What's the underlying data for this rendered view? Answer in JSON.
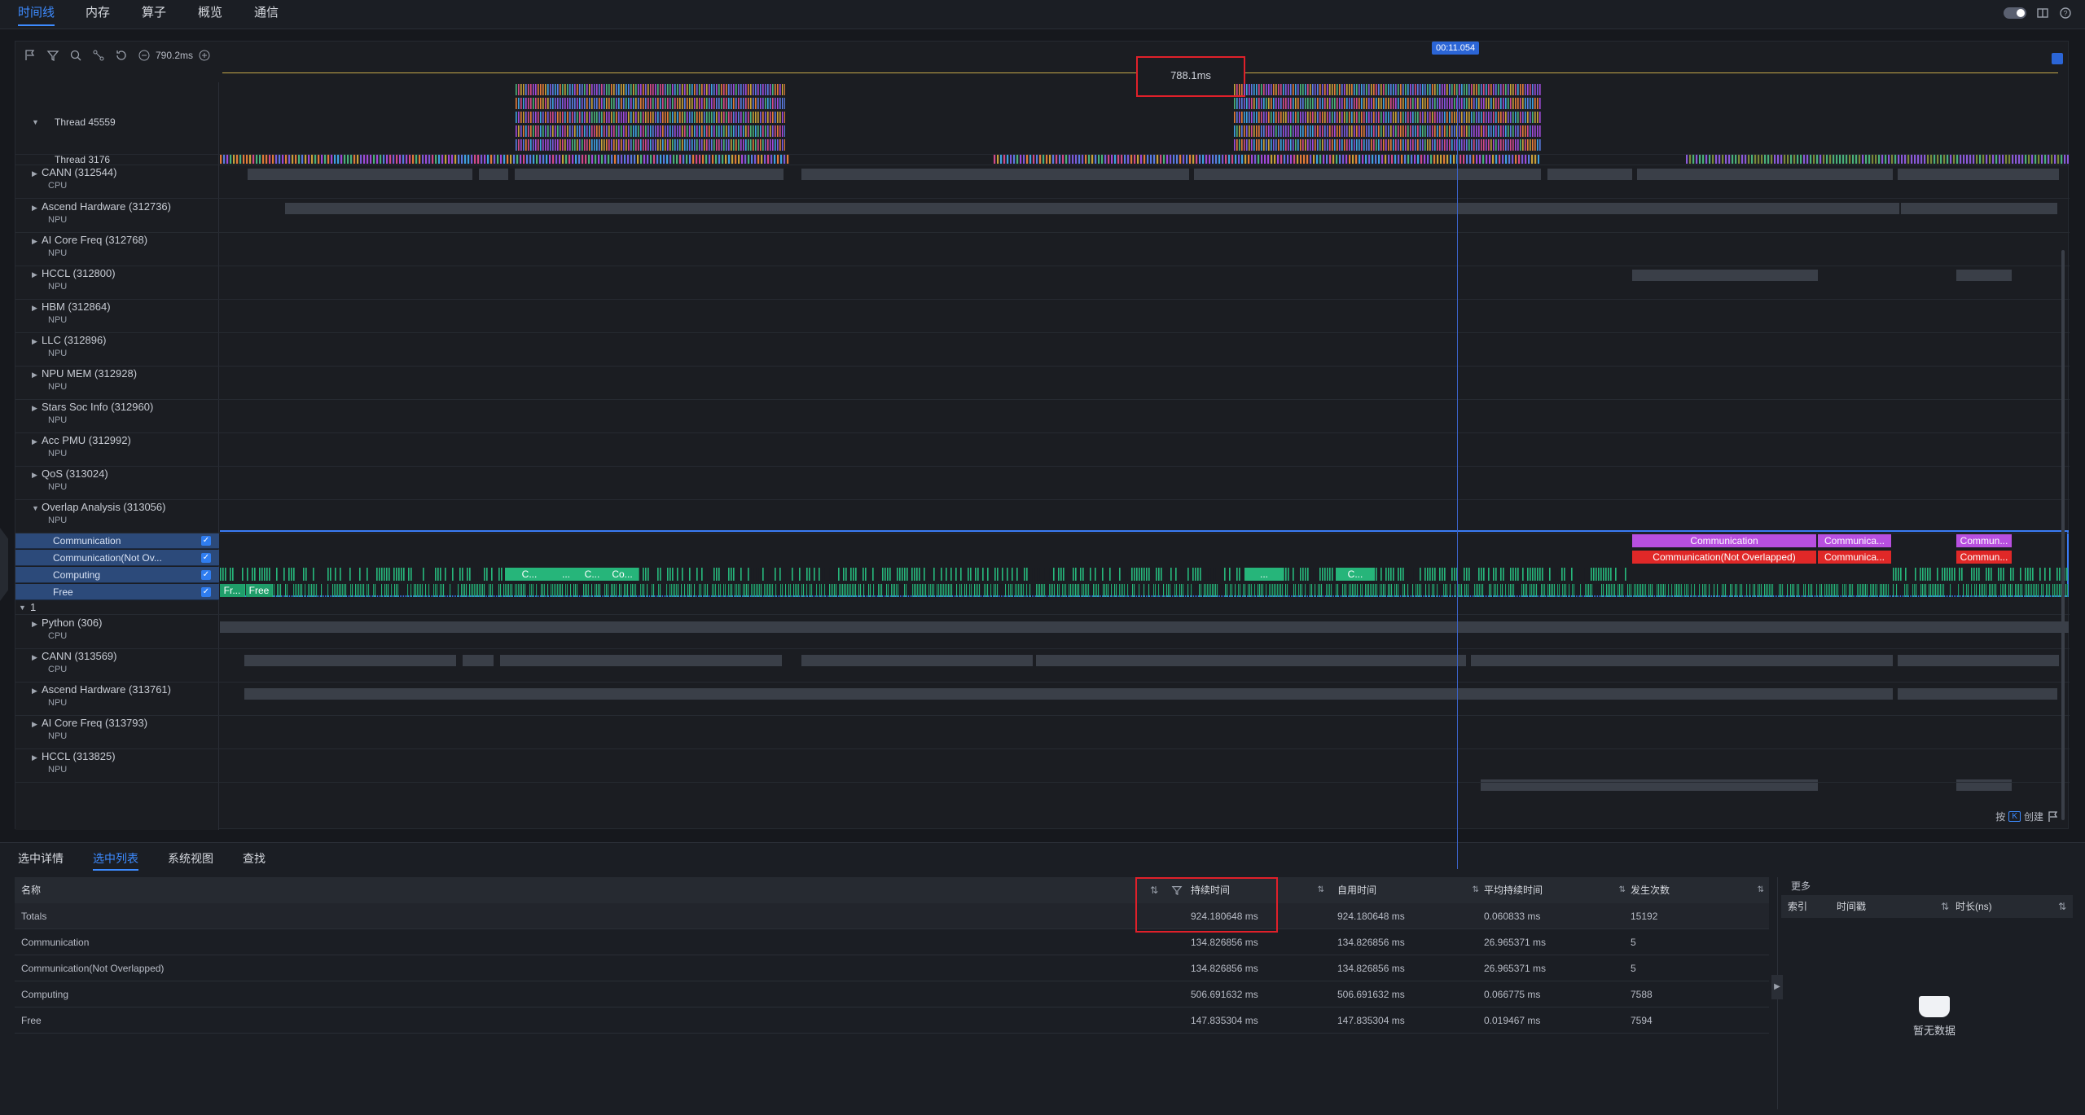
{
  "nav": {
    "tabs": [
      "时间线",
      "内存",
      "算子",
      "概览",
      "通信"
    ],
    "active": 0
  },
  "toolbar": {
    "zoom": "790.2ms"
  },
  "ruler": {
    "measure": "788.1ms",
    "cursor_time": "00:11.054"
  },
  "lanes": [
    {
      "title": "Thread 45559",
      "sub": ""
    },
    {
      "title": "Thread 3176",
      "sub": ""
    },
    {
      "title": "CANN (312544)",
      "sub": "CPU"
    },
    {
      "title": "Ascend Hardware (312736)",
      "sub": "NPU"
    },
    {
      "title": "AI Core Freq (312768)",
      "sub": "NPU"
    },
    {
      "title": "HCCL (312800)",
      "sub": "NPU"
    },
    {
      "title": "HBM (312864)",
      "sub": "NPU"
    },
    {
      "title": "LLC (312896)",
      "sub": "NPU"
    },
    {
      "title": "NPU MEM (312928)",
      "sub": "NPU"
    },
    {
      "title": "Stars Soc Info (312960)",
      "sub": "NPU"
    },
    {
      "title": "Acc PMU (312992)",
      "sub": "NPU"
    },
    {
      "title": "QoS (313024)",
      "sub": "NPU"
    },
    {
      "title": "Overlap Analysis (313056)",
      "sub": "NPU"
    }
  ],
  "overlap_rows": [
    "Communication",
    "Communication(Not Ov...",
    "Computing",
    "Free"
  ],
  "group2": {
    "title": "1"
  },
  "lanes2": [
    {
      "title": "Python (306)",
      "sub": "CPU"
    },
    {
      "title": "CANN (313569)",
      "sub": "CPU"
    },
    {
      "title": "Ascend Hardware (313761)",
      "sub": "NPU"
    },
    {
      "title": "AI Core Freq (313793)",
      "sub": "NPU"
    },
    {
      "title": "HCCL (313825)",
      "sub": "NPU"
    }
  ],
  "segments": {
    "comm1": "Communication",
    "comm2": "Communica...",
    "comm3": "Commun...",
    "nov1": "Communication(Not Overlapped)",
    "nov2": "Communica...",
    "nov3": "Commun...",
    "c1": "C...",
    "c2": "...",
    "c3": "C...",
    "c4": "Co...",
    "c5": "...",
    "c6": "C...",
    "f1": "Fr...",
    "f2": "Free"
  },
  "hint": {
    "prefix": "按",
    "key": "K",
    "suffix": "创建"
  },
  "bottom": {
    "tabs": [
      "选中详情",
      "选中列表",
      "系统视图",
      "查找"
    ],
    "active": 1,
    "headers": [
      "名称",
      "持续时间",
      "自用时间",
      "平均持续时间",
      "发生次数"
    ],
    "rows": [
      [
        "Totals",
        "924.180648 ms",
        "924.180648 ms",
        "0.060833 ms",
        "15192"
      ],
      [
        "Communication",
        "134.826856 ms",
        "134.826856 ms",
        "26.965371 ms",
        "5"
      ],
      [
        "Communication(Not Overlapped)",
        "134.826856 ms",
        "134.826856 ms",
        "26.965371 ms",
        "5"
      ],
      [
        "Computing",
        "506.691632 ms",
        "506.691632 ms",
        "0.066775 ms",
        "7588"
      ],
      [
        "Free",
        "147.835304 ms",
        "147.835304 ms",
        "0.019467 ms",
        "7594"
      ]
    ]
  },
  "side": {
    "more": "更多",
    "headers": [
      "索引",
      "时间戳",
      "时长(ns)"
    ],
    "empty": "暂无数据"
  },
  "colors": {
    "accent": "#3d8bff",
    "communication": "#b84fe0",
    "not_overlapped": "#e02828",
    "computing": "#26b57a",
    "free": "#1f9e6a",
    "highlight": "#e0202a"
  }
}
